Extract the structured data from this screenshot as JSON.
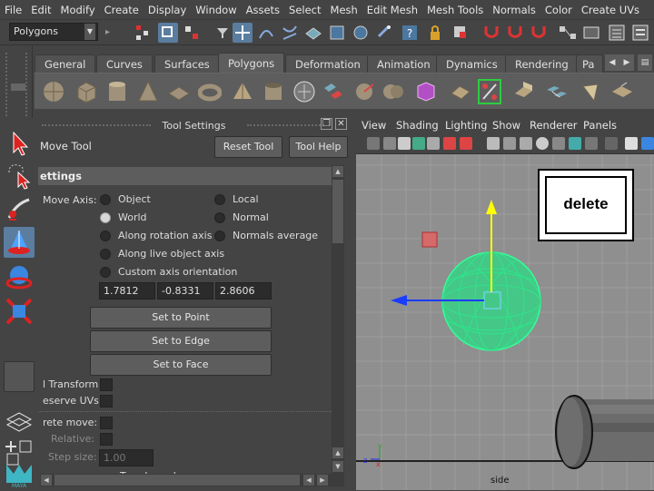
{
  "menubar": {
    "items": [
      "File",
      "Edit",
      "Modify",
      "Create",
      "Display",
      "Window",
      "Assets",
      "Select",
      "Mesh",
      "Edit Mesh",
      "Mesh Tools",
      "Normals",
      "Color",
      "Create UVs"
    ]
  },
  "statusline": {
    "mode": "Polygons"
  },
  "shelf": {
    "tabs": [
      "General",
      "Curves",
      "Surfaces",
      "Polygons",
      "Deformation",
      "Animation",
      "Dynamics",
      "Rendering",
      "Pa"
    ],
    "active_tab": "Polygons"
  },
  "tool_settings": {
    "title": "Tool Settings",
    "tool_name": "Move Tool",
    "reset_label": "Reset Tool",
    "help_label": "Tool Help",
    "section_header": "ettings",
    "move_axis_label": "Move Axis:",
    "options": {
      "object": "Object",
      "local": "Local",
      "world": "World",
      "normal": "Normal",
      "along_rotation": "Along rotation axis",
      "normals_average": "Normals average",
      "along_live": "Along live object axis",
      "custom_axis": "Custom axis orientation"
    },
    "selected_axis": "World",
    "fields": [
      "1.7812",
      "-0.8331",
      "2.8606"
    ],
    "set_to_point": "Set to Point",
    "set_to_edge": "Set to Edge",
    "set_to_face": "Set to Face",
    "retain_transform": "l Transform",
    "preserve_uvs": "eserve UVs",
    "discrete_move": "rete move:",
    "relative": "Relative:",
    "step_size_label": "Step size:",
    "step_size_value": "1.00",
    "tweak_mode": "Tweak mode"
  },
  "viewport": {
    "menu": [
      "View",
      "Shading",
      "Lighting",
      "Show",
      "Renderer",
      "Panels"
    ],
    "camera_label": "side",
    "overlay_key": "delete"
  },
  "colors": {
    "bg": "#444444",
    "viewport_bg": "#8f8f8f",
    "wireframe": "#33ff99",
    "y_axis": "#ffff00",
    "x_axis": "#1a3cff"
  }
}
